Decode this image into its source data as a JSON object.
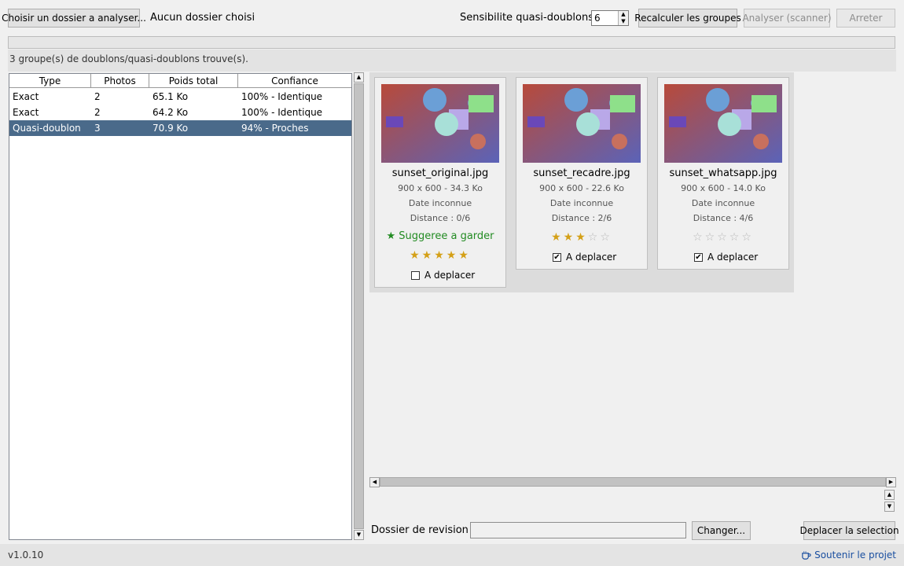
{
  "toolbar": {
    "choose_folder_label": "Choisir un dossier a analyser...",
    "folder_status": "Aucun dossier choisi",
    "sensitivity_label": "Sensibilite quasi-doublons :",
    "sensitivity_value": "6",
    "recalc_label": "Recalculer les groupes",
    "analyze_label": "Analyser (scanner)",
    "stop_label": "Arreter"
  },
  "progress": 0,
  "status_message": "3 groupe(s) de doublons/quasi-doublons trouve(s).",
  "table": {
    "columns": [
      "Type",
      "Photos",
      "Poids total",
      "Confiance"
    ],
    "rows": [
      {
        "type": "Exact",
        "photos": "2",
        "size": "65.1 Ko",
        "confidence": "100% - Identique"
      },
      {
        "type": "Exact",
        "photos": "2",
        "size": "64.2 Ko",
        "confidence": "100% - Identique"
      },
      {
        "type": "Quasi-doublon",
        "photos": "3",
        "size": "70.9 Ko",
        "confidence": "94% - Proches"
      }
    ],
    "selected_row": 2
  },
  "cards": [
    {
      "name": "sunset_original.jpg",
      "dims": "900 x 600 - 34.3 Ko",
      "date": "Date inconnue",
      "distance": "Distance : 0/6",
      "suggestion": "★ Suggeree a garder",
      "rating": 5,
      "move_label": "A deplacer",
      "move_checked": false
    },
    {
      "name": "sunset_recadre.jpg",
      "dims": "900 x 600 - 22.6 Ko",
      "date": "Date inconnue",
      "distance": "Distance : 2/6",
      "suggestion": "",
      "rating": 3,
      "move_label": "A deplacer",
      "move_checked": true
    },
    {
      "name": "sunset_whatsapp.jpg",
      "dims": "900 x 600 - 14.0 Ko",
      "date": "Date inconnue",
      "distance": "Distance : 4/6",
      "suggestion": "",
      "rating": 0,
      "move_label": "A deplacer",
      "move_checked": true
    }
  ],
  "review": {
    "label": "Dossier de revision :",
    "value": "",
    "change_label": "Changer...",
    "move_selection_label": "Deplacer la selection"
  },
  "footer": {
    "version": "v1.0.10",
    "support_label": "Soutenir le projet"
  },
  "colors": {
    "selected_row": "#4a6a8a",
    "star_on": "#d4a017",
    "keep_green": "#228b22",
    "link_blue": "#1a4fa0"
  }
}
